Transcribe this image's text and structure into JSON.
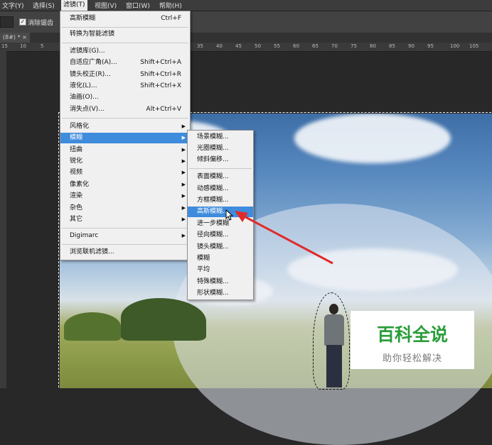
{
  "menubar": {
    "items": [
      "文字(Y)",
      "选择(S)",
      "滤镜(T)",
      "视图(V)",
      "窗口(W)",
      "帮助(H)"
    ]
  },
  "options": {
    "antialias_label": "消除锯齿"
  },
  "tab": {
    "label": "(8#) * ×"
  },
  "ruler": {
    "ticks": [
      "15",
      "10",
      "5",
      "35",
      "40",
      "45",
      "50",
      "55",
      "60",
      "65",
      "70",
      "75",
      "80",
      "85",
      "90",
      "95",
      "100",
      "105"
    ]
  },
  "filter_menu": {
    "items": [
      {
        "label": "高斯模糊",
        "shortcut": "Ctrl+F"
      },
      {
        "label": "转换为智能滤镜"
      },
      {
        "label": "滤镜库(G)..."
      },
      {
        "label": "自适应广角(A)...",
        "shortcut": "Shift+Ctrl+A"
      },
      {
        "label": "镜头校正(R)...",
        "shortcut": "Shift+Ctrl+R"
      },
      {
        "label": "液化(L)...",
        "shortcut": "Shift+Ctrl+X"
      },
      {
        "label": "油画(O)..."
      },
      {
        "label": "消失点(V)...",
        "shortcut": "Alt+Ctrl+V"
      },
      {
        "label": "风格化"
      },
      {
        "label": "模糊"
      },
      {
        "label": "扭曲"
      },
      {
        "label": "锐化"
      },
      {
        "label": "视频"
      },
      {
        "label": "像素化"
      },
      {
        "label": "渲染"
      },
      {
        "label": "杂色"
      },
      {
        "label": "其它"
      },
      {
        "label": "Digimarc"
      },
      {
        "label": "浏览联机滤镜..."
      }
    ]
  },
  "blur_submenu": {
    "items": [
      "场景模糊...",
      "光圈模糊...",
      "倾斜偏移...",
      "表面模糊...",
      "动感模糊...",
      "方框模糊...",
      "高斯模糊...",
      "进一步模糊",
      "径向模糊...",
      "镜头模糊...",
      "模糊",
      "平均",
      "特殊模糊...",
      "形状模糊..."
    ]
  },
  "watermark": {
    "title": "百科全说",
    "subtitle": "助你轻松解决"
  },
  "colors": {
    "highlight": "#3f8bdc",
    "annotation_arrow": "#e02b2b",
    "watermark_green": "#2a9d3a"
  }
}
